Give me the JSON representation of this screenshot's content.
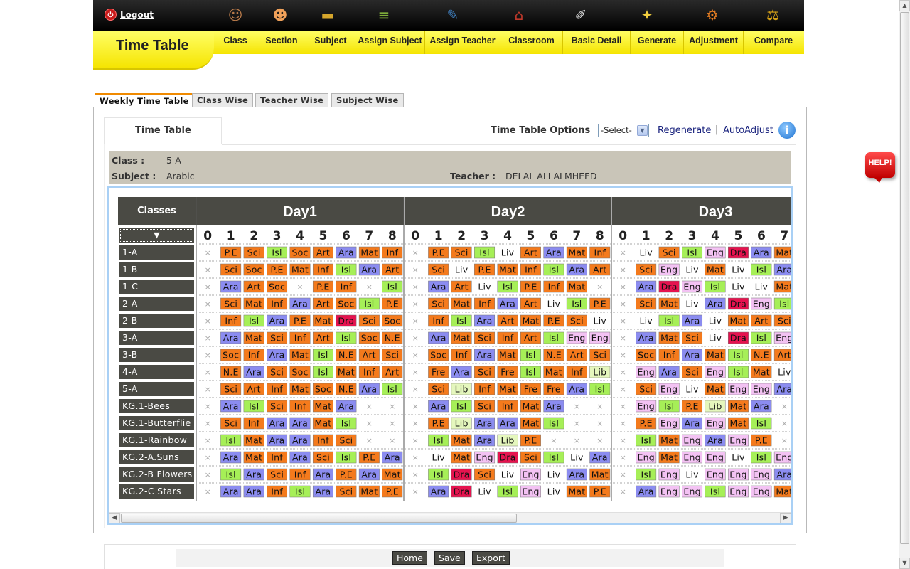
{
  "header": {
    "logout_label": "Logout",
    "page_title": "Time Table",
    "nav_icons": [
      "users-icon",
      "people-icon",
      "book-icon",
      "books-stack-icon",
      "teacher-icon",
      "school-icon",
      "notepad-icon",
      "lightbulb-icon",
      "gear-icon",
      "scales-icon"
    ],
    "menu": [
      "Class",
      "Section",
      "Subject",
      "Assign Subject",
      "Assign Teacher",
      "Classroom",
      "Basic Detail",
      "Generate",
      "Adjustment",
      "Compare"
    ]
  },
  "tabs": [
    "Weekly Time Table",
    "Class Wise",
    "Teacher Wise",
    "Subject Wise"
  ],
  "active_tab": "Weekly Time Table",
  "subtab": "Time Table",
  "options": {
    "label": "Time Table Options",
    "select_value": "-Select-",
    "regenerate": "Regenerate",
    "separator": "|",
    "autoadjust": "AutoAdjust",
    "info_icon": "i"
  },
  "info": {
    "class_label": "Class :",
    "class_value": "5-A",
    "subject_label": "Subject :",
    "subject_value": "Arabic",
    "teacher_label": "Teacher :",
    "teacher_value": "DELAL ALI ALMHEED"
  },
  "grid": {
    "classes_header": "Classes",
    "sort_icon": "▼",
    "days": [
      "Day1",
      "Day2",
      "Day3"
    ],
    "periods": [
      "0",
      "1",
      "2",
      "3",
      "4",
      "5",
      "6",
      "7",
      "8"
    ],
    "classes": [
      "1-A",
      "1-B",
      "1-C",
      "2-A",
      "2-B",
      "3-A",
      "3-B",
      "4-A",
      "5-A",
      "KG.1-Bees",
      "KG.1-Butterflie",
      "KG.1-Rainbow",
      "KG.2-A.Suns",
      "KG.2-B Flowers",
      "KG.2-C Stars"
    ],
    "rows": [
      [
        "P.E Sci Isl Soc Art Ara Mat Inf",
        "P.E Sci Isl Liv Art Ara Mat Inf",
        "Liv Sci Isl Eng Dra Ara Mat"
      ],
      [
        "Sci Soc P.E Mat Inf Isl Ara Art",
        "Sci Liv P.E Mat Inf Isl Ara Art",
        "Sci Eng Liv Mat Liv Isl Ara"
      ],
      [
        "Ara Art Soc - P.E Inf - Isl",
        "Ara Art Liv Isl P.E Inf Mat -",
        "Ara Dra Eng Isl Liv Liv Mat"
      ],
      [
        "Sci Mat Inf Ara Art Soc Isl P.E",
        "Sci Mat Inf Ara Art Liv Isl P.E",
        "Sci Mat Liv Ara Dra Eng Isl"
      ],
      [
        "Inf Isl Ara P.E Mat Dra Sci Soc",
        "Inf Isl Ara Art Mat P.E Sci Liv",
        "Liv Isl Ara Liv Mat Art Sci"
      ],
      [
        "Ara Mat Sci Inf Art Isl Soc N.E",
        "Ara Mat Sci Inf Art Isl Eng Eng",
        "Ara Mat Sci Liv Dra Isl Eng"
      ],
      [
        "Soc Inf Ara Mat Isl N.E Art Sci",
        "Soc Inf Ara Mat Isl N.E Art Sci",
        "Soc Inf Ara Mat Isl N.E Art"
      ],
      [
        "N.E Ara Sci Soc Isl Mat Inf Art",
        "Fre Ara Sci Fre Isl Mat Inf Lib",
        "Eng Ara Sci Eng Isl Mat Liv"
      ],
      [
        "Sci Art Inf Mat Soc N.E Ara Isl",
        "Sci Lib Inf Mat Fre Fre Ara Isl",
        "Sci Eng Liv Mat Eng Eng Ara"
      ],
      [
        "Ara Isl Sci Inf Mat Ara - -",
        "Ara Isl Sci Inf Mat Ara - -",
        "Eng Isl P.E Lib Mat Ara -"
      ],
      [
        "Sci Inf Ara Ara Mat Isl - -",
        "P.E Lib Ara Ara Mat Isl - -",
        "P.E Eng Ara Eng Mat Isl -"
      ],
      [
        "Isl Mat Ara Ara Inf Sci - -",
        "Isl Mat Ara Lib P.E - -",
        "Isl Mat Eng Ara Eng P.E -"
      ],
      [
        "Ara Mat Inf Ara Sci Isl P.E Ara",
        "Liv Mat Eng Dra Sci Isl Liv Ara",
        "Eng Mat Eng Eng Liv Isl Eng"
      ],
      [
        "Isl Ara Sci Inf Ara P.E Ara Mat",
        "Isl Dra Sci Liv Eng Liv Ara Mat",
        "Isl Eng Liv Eng Eng Eng Ara"
      ],
      [
        "Ara Ara Inf Isl Ara Sci Mat P.E",
        "Ara Dra Liv Isl Eng Liv Mat P.E",
        "Ara Eng Eng Isl Eng Eng Mat"
      ]
    ],
    "empty_symbol": "×",
    "subject_colors": {
      "P.E": "#f47a1c",
      "Sci": "#f47a1c",
      "Soc": "#f47a1c",
      "Art": "#f47a1c",
      "Mat": "#f47a1c",
      "Inf": "#f47a1c",
      "N.E": "#f47a1c",
      "Fre": "#f47a1c",
      "Isl": "#a6ef57",
      "Lib": "#e5f7bd",
      "Liv": "#ffffff",
      "Ara": "#8b8cf0",
      "Eng": "#f3c2f3",
      "Dra": "#e5134f"
    }
  },
  "footer": {
    "home": "Home",
    "save": "Save",
    "export": "Export"
  },
  "help_label": "HELP!"
}
